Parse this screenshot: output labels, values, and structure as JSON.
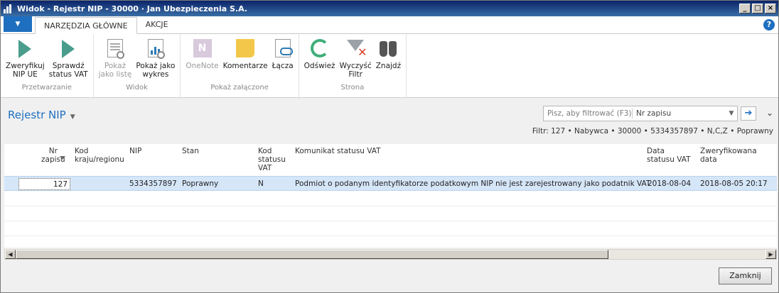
{
  "window": {
    "title": "Widok - Rejestr NIP - 30000 · Jan Ubezpieczenia S.A.",
    "buttons": {
      "minimize": "_",
      "maximize": "□",
      "close": "×"
    }
  },
  "tabs": [
    {
      "label": "NARZĘDZIA GŁÓWNE",
      "active": true
    },
    {
      "label": "AKCJE",
      "active": false
    }
  ],
  "ribbon": {
    "groups": [
      {
        "label": "Przetwarzanie",
        "buttons": [
          {
            "label1": "Zweryfikuj",
            "label2": "NIP UE",
            "icon": "play-icon"
          },
          {
            "label1": "Sprawdź",
            "label2": "status VAT",
            "icon": "play-icon"
          }
        ]
      },
      {
        "label": "Widok",
        "buttons": [
          {
            "label1": "Pokaż",
            "label2": "jako listę",
            "icon": "list-view-icon",
            "disabled": true
          },
          {
            "label1": "Pokaż jako",
            "label2": "wykres",
            "icon": "chart-view-icon"
          }
        ]
      },
      {
        "label": "Pokaż załączone",
        "buttons": [
          {
            "label1": "OneNote",
            "label2": "",
            "icon": "onenote-icon",
            "disabled": true
          },
          {
            "label1": "Komentarze",
            "label2": "",
            "icon": "note-icon"
          },
          {
            "label1": "Łącza",
            "label2": "",
            "icon": "links-icon"
          }
        ]
      },
      {
        "label": "Strona",
        "buttons": [
          {
            "label1": "Odśwież",
            "label2": "",
            "icon": "refresh-icon"
          },
          {
            "label1": "Wyczyść",
            "label2": "Filtr",
            "icon": "clear-filter-icon"
          },
          {
            "label1": "Znajdź",
            "label2": "",
            "icon": "binoculars-icon"
          }
        ]
      }
    ]
  },
  "page": {
    "title": "Rejestr NIP",
    "search_placeholder": "Pisz, aby filtrować (F3)",
    "search_field": "Nr zapisu",
    "filter_text": "Filtr: 127 • Nabywca • 30000 • 5334357897 • N,C,Z • Poprawny"
  },
  "columns": [
    {
      "line1": "Nr",
      "line2": "zapisu",
      "line3": ""
    },
    {
      "line1": "Kod",
      "line2": "kraju/regionu",
      "line3": ""
    },
    {
      "line1": "NIP",
      "line2": "",
      "line3": ""
    },
    {
      "line1": "Stan",
      "line2": "",
      "line3": ""
    },
    {
      "line1": "Kod",
      "line2": "statusu",
      "line3": "VAT"
    },
    {
      "line1": "Komunikat statusu VAT",
      "line2": "",
      "line3": ""
    },
    {
      "line1": "Data",
      "line2": "statusu VAT",
      "line3": ""
    },
    {
      "line1": "Zweryfikowana",
      "line2": "data",
      "line3": ""
    }
  ],
  "rows": [
    {
      "nr_zapisu": "127",
      "kod_kraju": "",
      "nip": "5334357897",
      "stan": "Poprawny",
      "kod_statusu_vat": "N",
      "komunikat": "Podmiot o podanym identyfikatorze podatkowym NIP nie jest zarejestrowany jako podatnik VAT",
      "data_statusu_vat": "2018-08-04",
      "zweryfikowana_data": "2018-08-05 20:17"
    }
  ],
  "footer": {
    "close_label": "Zamknij"
  }
}
